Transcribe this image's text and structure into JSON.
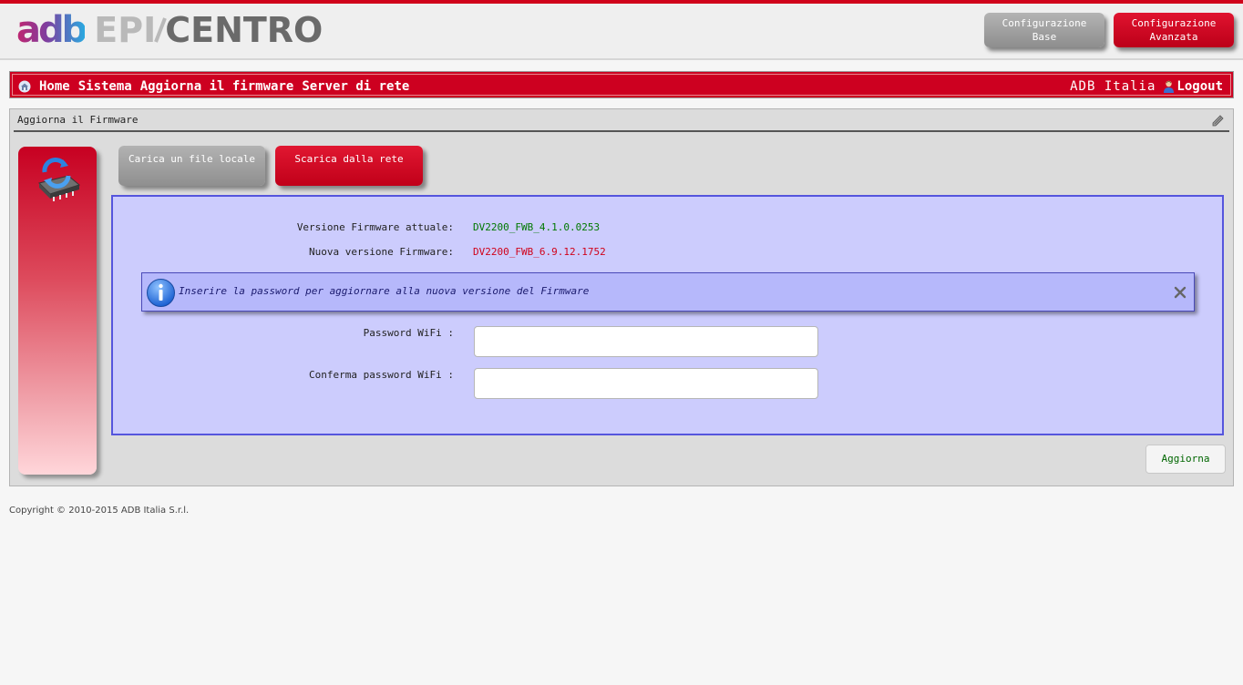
{
  "header": {
    "logo_adb": "adb",
    "logo_epi": "EPI",
    "logo_centro": "CENTRO",
    "buttons": {
      "base_line1": "Configurazione",
      "base_line2": "Base",
      "advanced_line1": "Configurazione",
      "advanced_line2": "Avanzata"
    }
  },
  "nav": {
    "items": [
      "Home",
      "Sistema",
      "Aggiorna il firmware",
      "Server di rete"
    ],
    "company": "ADB Italia",
    "logout": "Logout"
  },
  "panel": {
    "title": "Aggiorna il Firmware",
    "tabs": {
      "local": "Carica un file locale",
      "network": "Scarica dalla rete"
    },
    "current_fw_label": "Versione Firmware attuale:",
    "current_fw_value": "DV2200_FWB_4.1.0.0253",
    "new_fw_label": "Nuova versione Firmware:",
    "new_fw_value": "DV2200_FWB_6.9.12.1752",
    "info_message": "Inserire la password per aggiornare alla nuova versione del Firmware",
    "password_label": "Password WiFi :",
    "password_value": "",
    "confirm_label": "Conferma password WiFi :",
    "confirm_value": "",
    "update_button": "Aggiorna"
  },
  "footer": {
    "copyright": "Copyright © 2010-2015 ADB Italia S.r.l."
  },
  "colors": {
    "brand_red": "#cd0020",
    "content_bg": "#ccccfd",
    "current_fw": "#007800",
    "new_fw": "#d0021b"
  },
  "icons": [
    "home-icon",
    "user-icon",
    "edit-icon",
    "firmware-update-icon",
    "info-icon",
    "close-icon"
  ]
}
